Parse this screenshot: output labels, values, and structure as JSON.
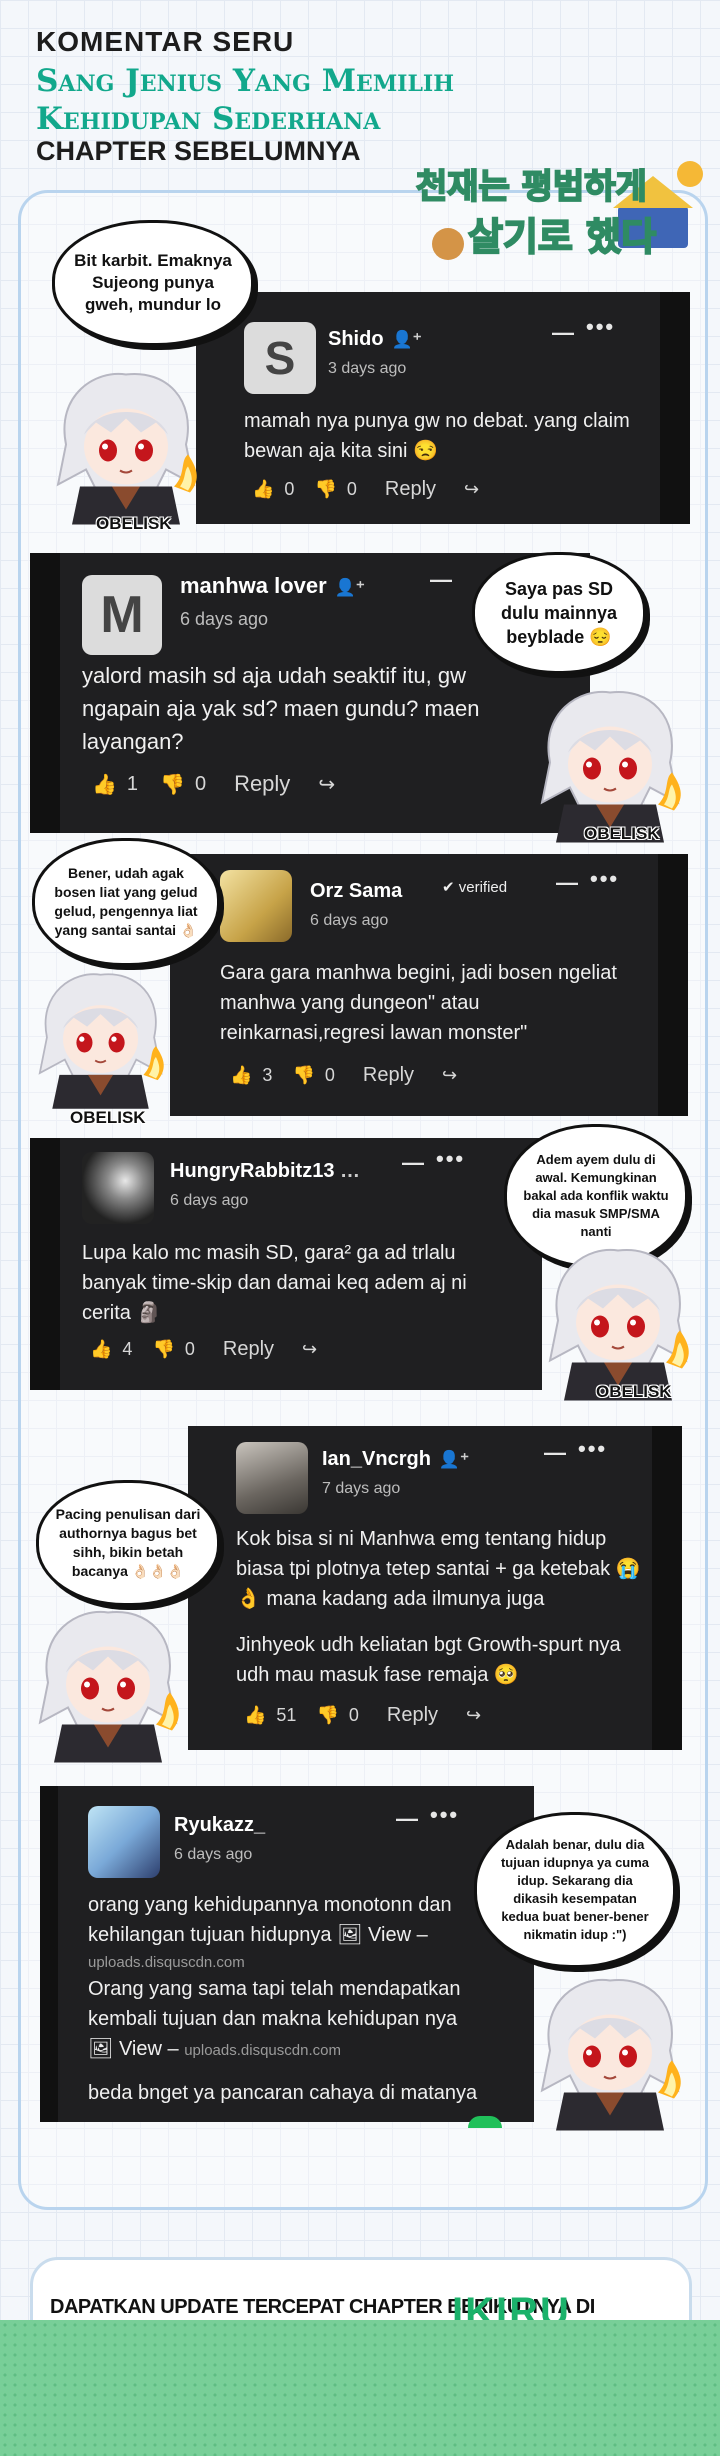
{
  "header": {
    "line1": "KOMENTAR SERU",
    "line2": "Sang Jenius Yang Memilih",
    "line3": "Kehidupan Sederhana",
    "line4": "CHAPTER SEBELUMNYA",
    "logo_text_top": "천재는 평범하게",
    "logo_text_bottom": "살기로 했다"
  },
  "colors": {
    "accent": "#12a88c",
    "card_bg": "#1f1f21",
    "frame": "#b9d4ee",
    "footer_green": "#78cf98"
  },
  "icons": {
    "like": "thumbs-up-icon",
    "dislike": "thumbs-down-icon",
    "share": "share-icon",
    "follow": "add-user-icon",
    "more": "more-icon",
    "collapse": "minus-icon"
  },
  "obelisk_label": "OBELISK",
  "comments": [
    {
      "username": "Shido",
      "avatar_letter": "S",
      "time": "3 days ago",
      "text": "mamah nya punya gw no debat. yang claim bewan aja kita sini 😒",
      "likes": "0",
      "dislikes": "0",
      "reply": "Reply",
      "bubble": "Bit karbit. Emaknya Sujeong punya gweh, mundur lo"
    },
    {
      "username": "manhwa lover",
      "avatar_letter": "M",
      "time": "6 days ago",
      "text": "yalord masih sd aja udah seaktif itu, gw ngapain aja yak sd? maen gundu? maen layangan?",
      "likes": "1",
      "dislikes": "0",
      "reply": "Reply",
      "bubble": "Saya pas SD dulu mainnya beyblade 😔"
    },
    {
      "username": "Orz Sama",
      "badge": "verified",
      "time": "6 days ago",
      "text": "Gara gara manhwa begini, jadi bosen ngeliat manhwa yang dungeon\" atau reinkarnasi,regresi lawan monster\"",
      "likes": "3",
      "dislikes": "0",
      "reply": "Reply",
      "bubble": "Bener, udah agak bosen liat yang gelud gelud, pengennya liat yang santai santai 👌🏻"
    },
    {
      "username": "HungryRabbitz13",
      "time": "6 days ago",
      "text": "Lupa kalo mc masih SD, gara² ga ad trlalu banyak time-skip dan damai keq adem aj ni cerita 🗿",
      "likes": "4",
      "dislikes": "0",
      "reply": "Reply",
      "bubble": "Adem ayem dulu di awal. Kemungkinan bakal ada konflik waktu dia masuk SMP/SMA nanti"
    },
    {
      "username": "Ian_Vncrgh",
      "time": "7 days ago",
      "text": "Kok bisa si ni Manhwa emg tentang hidup biasa tpi plotnya tetep santai + ga ketebak 😭👌 mana kadang ada ilmunya juga",
      "text2": "Jinhyeok udh keliatan bgt Growth-spurt nya udh mau masuk fase remaja 🥺",
      "likes": "51",
      "dislikes": "0",
      "reply": "Reply",
      "bubble": "Pacing penulisan dari authornya bagus bet sihh, bikin betah bacanya 👌🏻👌🏻👌🏻"
    },
    {
      "username": "Ryukazz_",
      "time": "6 days ago",
      "text": "orang yang kehidupannya monotonn dan kehilangan tujuan hidupnya 🖼 View –",
      "link1": "uploads.disquscdn.com",
      "text2": "Orang yang sama tapi telah mendapatkan kembali tujuan dan makna kehidupan nya",
      "view2": "🖼 View –",
      "link2": "uploads.disquscdn.com",
      "text3": "beda bnget ya pancaran cahaya di matanya",
      "bubble": "Adalah benar, dulu dia tujuan idupnya ya cuma idup. Sekarang dia dikasih kesempatan kedua buat bener-bener nikmatin idup :\")"
    }
  ],
  "footer": {
    "text": "DAPATKAN UPDATE TERCEPAT CHAPTER BERIKUTNYA DI",
    "brand": "IKIRU"
  }
}
